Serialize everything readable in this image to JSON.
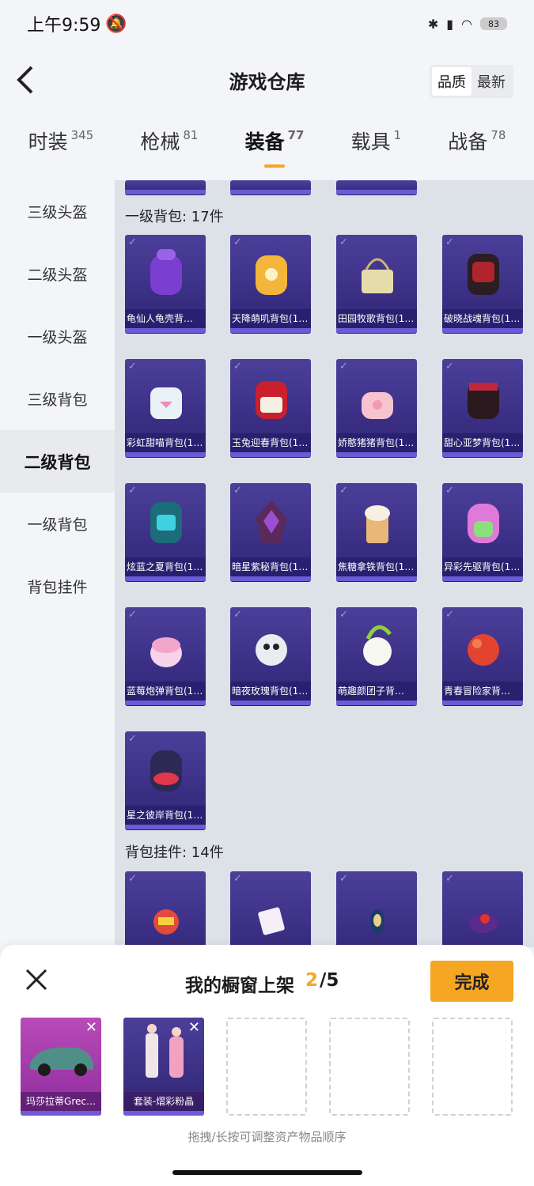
{
  "status": {
    "time": "上午9:59",
    "battery": "83"
  },
  "header": {
    "title": "游戏仓库",
    "sort": [
      "品质",
      "最新"
    ]
  },
  "tabs": [
    {
      "label": "时装",
      "count": "345"
    },
    {
      "label": "枪械",
      "count": "81"
    },
    {
      "label": "装备",
      "count": "77"
    },
    {
      "label": "载具",
      "count": "1"
    },
    {
      "label": "战备",
      "count": "78"
    }
  ],
  "sidebar": [
    "三级头盔",
    "二级头盔",
    "一级头盔",
    "三级背包",
    "二级背包",
    "一级背包",
    "背包挂件"
  ],
  "sections": {
    "backpack1_title": "一级背包: 17件",
    "backpack1_items": [
      "龟仙人龟壳背…",
      "天降萌叽背包(1…",
      "田园牧歌背包(1…",
      "破晓战魂背包(1…",
      "彩虹甜喵背包(1…",
      "玉兔迎春背包(1…",
      "娇憨猪猪背包(1…",
      "甜心亚梦背包(1…",
      "炫蓝之夏背包(1…",
      "暗星紫秘背包(1…",
      "焦糖拿铁背包(1…",
      "异彩先驱背包(1…",
      "蓝莓炮弹背包(1…",
      "暗夜玫瑰背包(1…",
      "萌趣颜团子背…",
      "青春冒险家背…",
      "星之彼岸背包(1…"
    ],
    "charm_title": "背包挂件: 14件"
  },
  "panel": {
    "title": "我的橱窗上架",
    "current": "2",
    "total": "/5",
    "done": "完成",
    "slots": [
      "玛莎拉蒂Grec…",
      "套装-熠彩粉晶"
    ],
    "hint": "拖拽/长按可调整资产物品顺序"
  }
}
